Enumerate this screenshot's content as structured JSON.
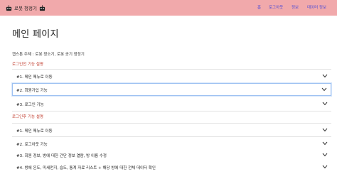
{
  "nav": {
    "brand": "로봇 청정기",
    "links": [
      "홈",
      "로그아웃",
      "정보",
      "데이터 정보"
    ]
  },
  "main": {
    "title": "메인 페이지",
    "subtitle": "캡스톤 주제 : 로봇 청소기, 로봇 공기 청정기",
    "section1": {
      "label": "로그인전 기능 설명",
      "items": [
        "#1. 메인 메뉴로 이동",
        "#2. 회원가입 기능",
        "#3. 로그인 기능"
      ]
    },
    "section2": {
      "label": "로그인후 기능 설명",
      "items": [
        "#1. 메인 메뉴로 이동",
        "#2. 로그아웃 기능",
        "#3. 회원 정보, 방에 대한 간단 정보 열람, 방 이름 수정",
        "#4. 방에 온도, 미세먼지, 습도, 통계 자료 리스트 + 해당 방에 대한 전체 데이터 확인"
      ]
    }
  },
  "colors": {
    "navbar_bg": "#f1a9ab",
    "nav_link": "#4a4ad6",
    "section_label": "#c0392b",
    "focus_border": "#9ec1f2"
  }
}
